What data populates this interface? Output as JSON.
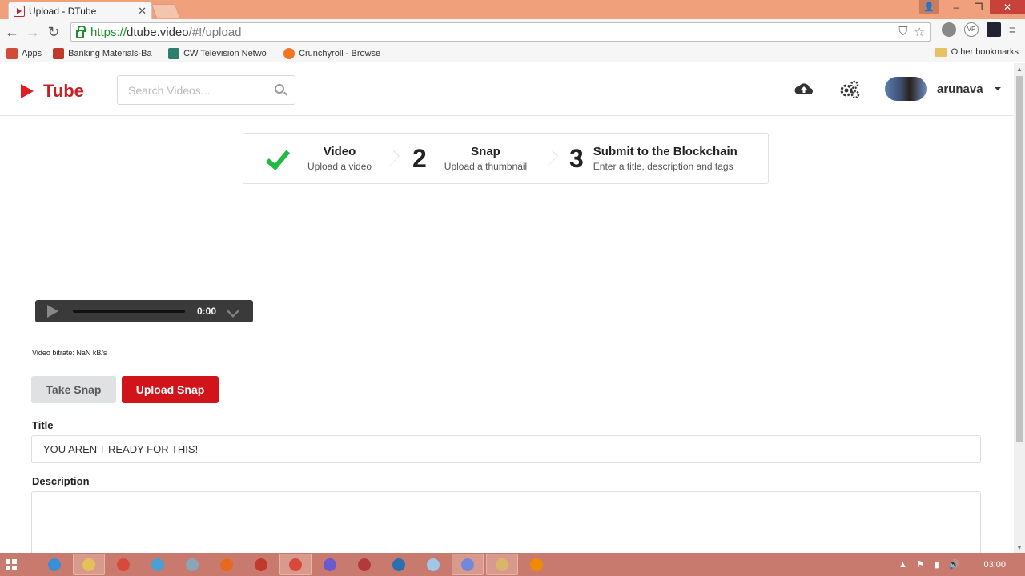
{
  "browser": {
    "tab_title": "Upload - DTube",
    "tab_close": "✕",
    "url_https": "https://",
    "url_domain": "dtube.video",
    "url_path": "/#!/upload",
    "window_buttons": {
      "minimize": "–",
      "restore": "❐",
      "close": "✕"
    },
    "bookmarks": [
      {
        "label": "Apps",
        "icon": "apps-grid-icon",
        "color": "#d24a3a"
      },
      {
        "label": "Banking Materials-Ba",
        "icon": "bank-icon",
        "color": "#c0392b"
      },
      {
        "label": "CW Television Netwo",
        "icon": "cw-icon",
        "color": "#2e7d6e"
      },
      {
        "label": "Crunchyroll - Browse",
        "icon": "crunchyroll-icon",
        "color": "#f47521"
      }
    ],
    "other_bookmarks": "Other bookmarks"
  },
  "header": {
    "logo_text": "Tube",
    "search_placeholder": "Search Videos...",
    "username": "arunava",
    "brand_color": "#e31b23"
  },
  "steps": [
    {
      "number": "",
      "title": "Video",
      "description": "Upload a video",
      "state": "done"
    },
    {
      "number": "2",
      "title": "Snap",
      "description": "Upload a thumbnail",
      "state": "current"
    },
    {
      "number": "3",
      "title": "Submit to the Blockchain",
      "description": "Enter a title, description and tags",
      "state": "pending"
    }
  ],
  "player": {
    "time": "0:00"
  },
  "bitrate": "Video bitrate: NaN kB/s",
  "buttons": {
    "take_snap": "Take Snap",
    "upload_snap": "Upload Snap"
  },
  "form": {
    "title_label": "Title",
    "title_value": "YOU AREN'T READY FOR THIS!",
    "description_label": "Description",
    "description_value": ""
  },
  "taskbar": {
    "clock": "03:00",
    "apps": [
      {
        "icon": "ie-icon",
        "color": "#3a8fd6"
      },
      {
        "icon": "explorer-icon",
        "color": "#e6c15a"
      },
      {
        "icon": "chrome-icon",
        "color": "#d8483b"
      },
      {
        "icon": "network-icon",
        "color": "#4a9fd3"
      },
      {
        "icon": "monitor-icon",
        "color": "#8aa5b8"
      },
      {
        "icon": "firefox-icon",
        "color": "#e66a1e"
      },
      {
        "icon": "app-red-icon",
        "color": "#c0392b"
      },
      {
        "icon": "chrome-active-icon",
        "color": "#d8483b"
      },
      {
        "icon": "edge-icon",
        "color": "#6a5acd"
      },
      {
        "icon": "app-circle-icon",
        "color": "#b23a3a"
      },
      {
        "icon": "drive-icon",
        "color": "#2a6fb0"
      },
      {
        "icon": "notepad-icon",
        "color": "#9ec7e8"
      },
      {
        "icon": "discord-icon",
        "color": "#7289da"
      },
      {
        "icon": "paint-icon",
        "color": "#d9b56a"
      },
      {
        "icon": "vlc-icon",
        "color": "#f08a00"
      }
    ]
  }
}
